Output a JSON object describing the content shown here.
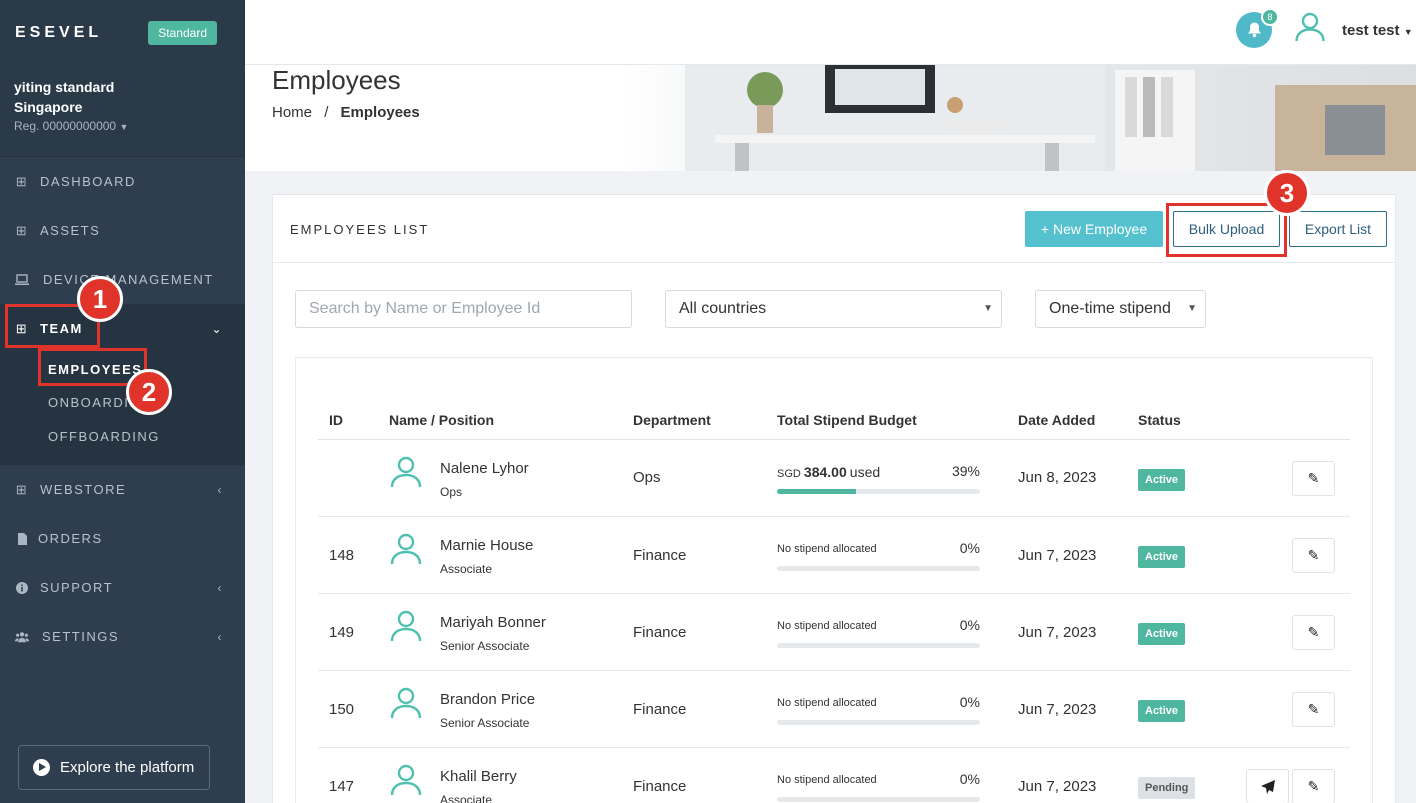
{
  "brand": {
    "logo": "ESEVEL",
    "plan": "Standard"
  },
  "company": {
    "name_line1": "yiting standard",
    "name_line2": "Singapore",
    "reg": "Reg. 00000000000"
  },
  "sidebar": {
    "items": [
      {
        "label": "DASHBOARD",
        "icon": "grid-icon"
      },
      {
        "label": "ASSETS",
        "icon": "grid-icon"
      },
      {
        "label": "DEVICE MANAGEMENT",
        "icon": "laptop-icon"
      },
      {
        "label": "TEAM",
        "icon": "grid-icon"
      },
      {
        "label": "WEBSTORE",
        "icon": "grid-icon"
      },
      {
        "label": "ORDERS",
        "icon": "file-icon"
      },
      {
        "label": "SUPPORT",
        "icon": "info-icon"
      },
      {
        "label": "SETTINGS",
        "icon": "users-icon"
      }
    ],
    "team_sub": [
      "EMPLOYEES",
      "ONBOARDING",
      "OFFBOARDING"
    ],
    "explore": "Explore the platform"
  },
  "topbar": {
    "notification_count": "8",
    "user_name": "test test"
  },
  "header": {
    "title": "Employees",
    "crumb_home": "Home",
    "crumb_sep": "/",
    "crumb_current": "Employees"
  },
  "card": {
    "title": "EMPLOYEES LIST",
    "new_button": "+ New Employee",
    "bulk_button": "Bulk Upload",
    "export_button": "Export List"
  },
  "filters": {
    "search_placeholder": "Search by Name or Employee Id",
    "country": "All countries",
    "stipend": "One-time stipend"
  },
  "table": {
    "headers": [
      "ID",
      "Name / Position",
      "Department",
      "Total Stipend Budget",
      "Date Added",
      "Status"
    ],
    "rows": [
      {
        "id": "",
        "name": "Nalene Lyhor",
        "position": "Ops",
        "department": "Ops",
        "stipend_currency": "SGD",
        "stipend_amount": "384.00",
        "stipend_suffix": "used",
        "stipend_text": "",
        "pct": "39%",
        "progress": 0.39,
        "date": "Jun 8, 2023",
        "status": "Active"
      },
      {
        "id": "148",
        "name": "Marnie House",
        "position": "Associate",
        "department": "Finance",
        "stipend_text": "No stipend allocated",
        "pct": "0%",
        "progress": 0,
        "date": "Jun 7, 2023",
        "status": "Active"
      },
      {
        "id": "149",
        "name": "Mariyah Bonner",
        "position": "Senior Associate",
        "department": "Finance",
        "stipend_text": "No stipend allocated",
        "pct": "0%",
        "progress": 0,
        "date": "Jun 7, 2023",
        "status": "Active"
      },
      {
        "id": "150",
        "name": "Brandon Price",
        "position": "Senior Associate",
        "department": "Finance",
        "stipend_text": "No stipend allocated",
        "pct": "0%",
        "progress": 0,
        "date": "Jun 7, 2023",
        "status": "Active"
      },
      {
        "id": "147",
        "name": "Khalil Berry",
        "position": "Associate",
        "department": "Finance",
        "stipend_text": "No stipend allocated",
        "pct": "0%",
        "progress": 0,
        "date": "Jun 7, 2023",
        "status": "Pending"
      }
    ]
  },
  "annotations": [
    "1",
    "2",
    "3"
  ],
  "colors": {
    "sidebar": "#2e3e4e",
    "accent": "#4fb7a0",
    "primary_button": "#55c1cf",
    "highlight": "#e0342b"
  }
}
